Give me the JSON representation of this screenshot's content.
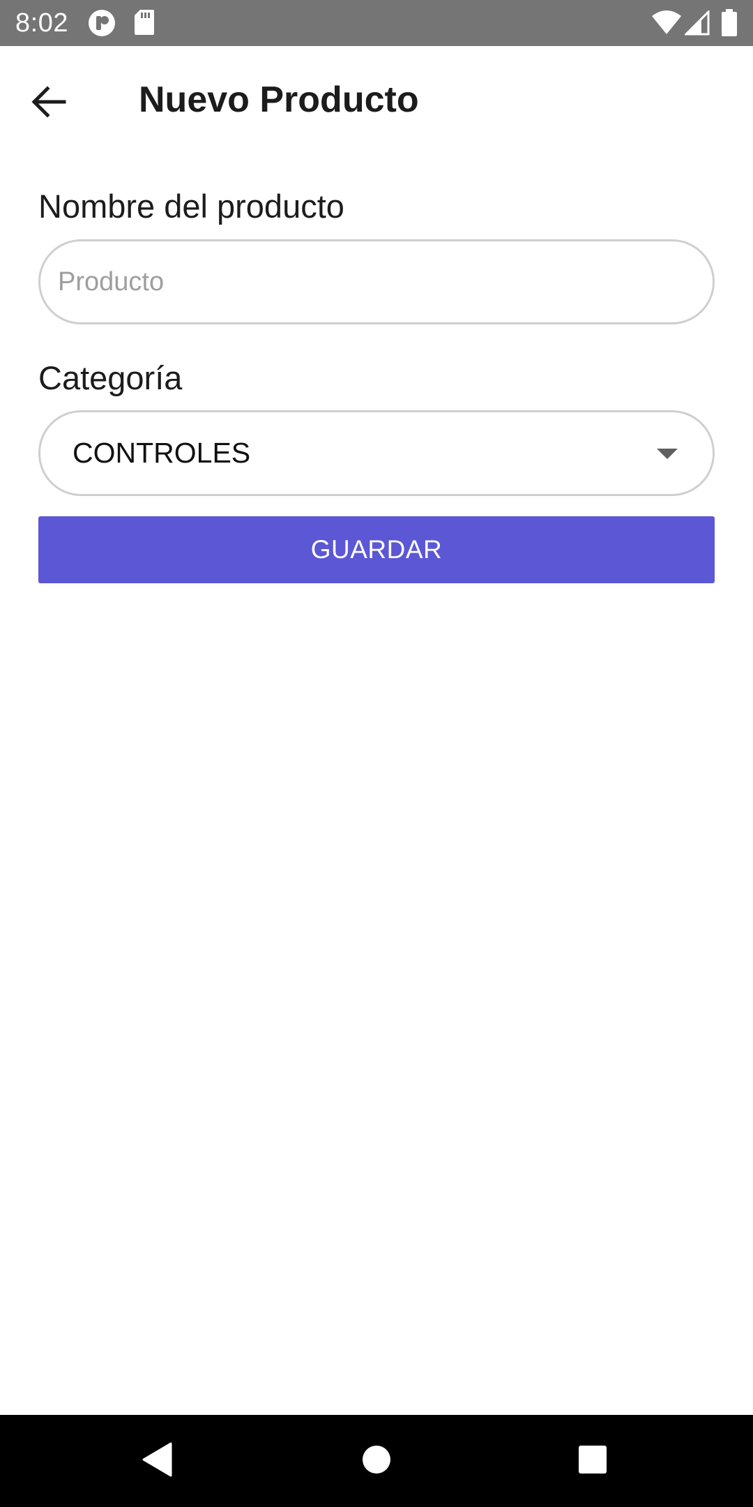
{
  "status_bar": {
    "time": "8:02",
    "left_icons": [
      "app-notification-icon",
      "sd-card-icon"
    ],
    "right_icons": [
      "wifi-icon",
      "cell-signal-icon",
      "battery-icon"
    ],
    "background": "#757575"
  },
  "app_bar": {
    "back_icon": "arrow-back-icon",
    "title": "Nuevo Producto"
  },
  "form": {
    "name_label": "Nombre del producto",
    "name_input": {
      "value": "",
      "placeholder": "Producto"
    },
    "category_label": "Categoría",
    "category_select": {
      "selected": "CONTROLES",
      "icon": "dropdown-arrow-icon"
    },
    "save_label": "GUARDAR"
  },
  "nav_bar": {
    "buttons": [
      "nav-back-icon",
      "nav-home-icon",
      "nav-recents-icon"
    ]
  },
  "colors": {
    "accent": "#5b57d5",
    "input_border": "#cfcfcf",
    "text": "#1c1c1c",
    "placeholder": "#9e9e9e"
  }
}
